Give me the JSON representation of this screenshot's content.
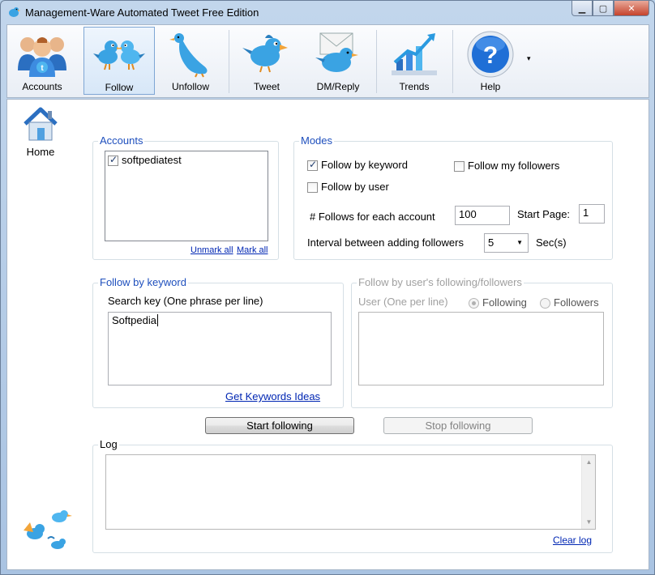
{
  "window": {
    "title": "Management-Ware Automated Tweet Free Edition",
    "minimize": "▁",
    "maximize": "▢",
    "close": "✕"
  },
  "toolbar": {
    "items": [
      {
        "label": "Accounts",
        "icon": "accounts-icon"
      },
      {
        "label": "Follow",
        "icon": "follow-icon"
      },
      {
        "label": "Unfollow",
        "icon": "unfollow-icon"
      },
      {
        "label": "Tweet",
        "icon": "tweet-icon"
      },
      {
        "label": "DM/Reply",
        "icon": "dm-reply-icon"
      },
      {
        "label": "Trends",
        "icon": "trends-icon"
      },
      {
        "label": "Help",
        "icon": "help-icon"
      }
    ],
    "help_dropdown": "▾"
  },
  "home": {
    "label": "Home"
  },
  "accounts": {
    "title": "Accounts",
    "items": [
      {
        "name": "softpediatest",
        "checked": true
      }
    ],
    "unmark_all": "Unmark all",
    "mark_all": "Mark all"
  },
  "modes": {
    "title": "Modes",
    "follow_by_keyword": "Follow by keyword",
    "follow_my_followers": "Follow my followers",
    "follow_by_user": "Follow by user",
    "follows_label": "# Follows for each account",
    "follows_value": "100",
    "start_page_label": "Start Page:",
    "start_page_value": "1",
    "interval_label": "Interval between adding followers",
    "interval_value": "5",
    "interval_unit": "Sec(s)"
  },
  "keyword": {
    "title": "Follow by keyword",
    "search_label": "Search key (One phrase per line)",
    "search_value": "Softpedia",
    "ideas_link": "Get Keywords Ideas"
  },
  "user_follow": {
    "title": "Follow by user's following/followers",
    "user_label": "User (One per line)",
    "following": "Following",
    "followers": "Followers"
  },
  "actions": {
    "start": "Start following",
    "stop": "Stop following"
  },
  "log": {
    "title": "Log",
    "clear": "Clear log"
  },
  "colors": {
    "accent": "#1e4fbd",
    "link": "#0026b3",
    "twitter_blue": "#3aa3e3"
  }
}
